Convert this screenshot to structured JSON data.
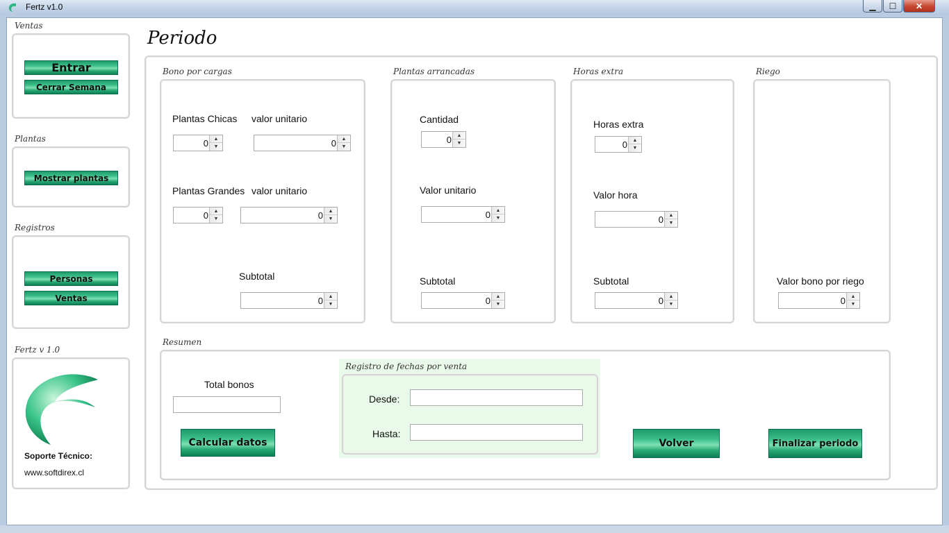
{
  "window": {
    "title": "Fertz v1.0",
    "min_glyph": "▁",
    "max_glyph": "☐",
    "close_glyph": "✕"
  },
  "sidebar": {
    "ventas": {
      "label": "Ventas",
      "entrar": "Entrar",
      "cerrar_semana": "Cerrar Semana"
    },
    "plantas": {
      "label": "Plantas",
      "mostrar": "Mostrar plantas"
    },
    "registros": {
      "label": "Registros",
      "personas": "Personas",
      "ventas": "Ventas"
    },
    "about": {
      "label": "Fertz v 1.0",
      "soporte": "Soporte Técnico:",
      "url": "www.softdirex.cl"
    }
  },
  "main": {
    "title": "Periodo",
    "bono": {
      "label": "Bono por cargas",
      "chicas_label": "Plantas Chicas",
      "chicas_value": "0",
      "chicas_unit_label": "valor unitario",
      "chicas_unit_value": "0",
      "grandes_label": "Plantas Grandes",
      "grandes_value": "0",
      "grandes_unit_label": "valor unitario",
      "grandes_unit_value": "0",
      "subtotal_label": "Subtotal",
      "subtotal_value": "0"
    },
    "arrancadas": {
      "label": "Plantas arrancadas",
      "cantidad_label": "Cantidad",
      "cantidad_value": "0",
      "unit_label": "Valor unitario",
      "unit_value": "0",
      "subtotal_label": "Subtotal",
      "subtotal_value": "0"
    },
    "horas": {
      "label": "Horas extra",
      "horas_label": "Horas extra",
      "horas_value": "0",
      "valor_label": "Valor hora",
      "valor_value": "0",
      "subtotal_label": "Subtotal",
      "subtotal_value": "0"
    },
    "riego": {
      "label": "Riego",
      "bono_label": "Valor bono por riego",
      "bono_value": "0"
    },
    "resumen": {
      "label": "Resumen",
      "total_label": "Total bonos",
      "total_value": "",
      "calcular": "Calcular datos",
      "fechas_label": "Registro de fechas por venta",
      "desde_label": "Desde:",
      "desde_value": "",
      "hasta_label": "Hasta:",
      "hasta_value": "",
      "volver": "Volver",
      "finalizar": "Finalizar periodo"
    }
  },
  "colors": {
    "accent_green": "#1f9a6a",
    "fechas_bg": "#eafaea"
  }
}
